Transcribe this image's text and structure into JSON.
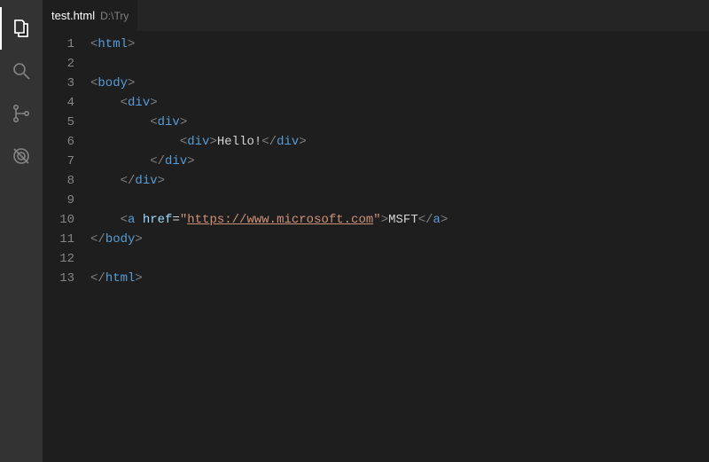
{
  "activitybar": {
    "items": [
      {
        "name": "explorer-icon",
        "active": true
      },
      {
        "name": "search-icon",
        "active": false
      },
      {
        "name": "source-control-icon",
        "active": false
      },
      {
        "name": "debug-icon",
        "active": false
      }
    ]
  },
  "tab": {
    "filename": "test.html",
    "directory": "D:\\Try"
  },
  "code": {
    "lines": [
      {
        "num": "1",
        "indent": "",
        "tokens": [
          [
            "punc",
            "<"
          ],
          [
            "tag",
            "html"
          ],
          [
            "punc",
            ">"
          ]
        ]
      },
      {
        "num": "2",
        "indent": "",
        "tokens": []
      },
      {
        "num": "3",
        "indent": "",
        "tokens": [
          [
            "punc",
            "<"
          ],
          [
            "tag",
            "body"
          ],
          [
            "punc",
            ">"
          ]
        ]
      },
      {
        "num": "4",
        "indent": "    ",
        "tokens": [
          [
            "punc",
            "<"
          ],
          [
            "tag",
            "div"
          ],
          [
            "punc",
            ">"
          ]
        ]
      },
      {
        "num": "5",
        "indent": "        ",
        "tokens": [
          [
            "punc",
            "<"
          ],
          [
            "tag",
            "div"
          ],
          [
            "punc",
            ">"
          ]
        ]
      },
      {
        "num": "6",
        "indent": "            ",
        "tokens": [
          [
            "punc",
            "<"
          ],
          [
            "tag",
            "div"
          ],
          [
            "punc",
            ">"
          ],
          [
            "text",
            "Hello!"
          ],
          [
            "punc",
            "</"
          ],
          [
            "tag",
            "div"
          ],
          [
            "punc",
            ">"
          ]
        ]
      },
      {
        "num": "7",
        "indent": "        ",
        "tokens": [
          [
            "punc",
            "</"
          ],
          [
            "tag",
            "div"
          ],
          [
            "punc",
            ">"
          ]
        ]
      },
      {
        "num": "8",
        "indent": "    ",
        "tokens": [
          [
            "punc",
            "</"
          ],
          [
            "tag",
            "div"
          ],
          [
            "punc",
            ">"
          ]
        ]
      },
      {
        "num": "9",
        "indent": "",
        "tokens": []
      },
      {
        "num": "10",
        "indent": "    ",
        "tokens": [
          [
            "punc",
            "<"
          ],
          [
            "tag",
            "a"
          ],
          [
            "text",
            " "
          ],
          [
            "attr",
            "href"
          ],
          [
            "op",
            "="
          ],
          [
            "str",
            "\""
          ],
          [
            "url",
            "https://www.microsoft.com"
          ],
          [
            "str",
            "\""
          ],
          [
            "punc",
            ">"
          ],
          [
            "text",
            "MSFT"
          ],
          [
            "punc",
            "</"
          ],
          [
            "tag",
            "a"
          ],
          [
            "punc",
            ">"
          ]
        ]
      },
      {
        "num": "11",
        "indent": "",
        "tokens": [
          [
            "punc",
            "</"
          ],
          [
            "tag",
            "body"
          ],
          [
            "punc",
            ">"
          ]
        ]
      },
      {
        "num": "12",
        "indent": "",
        "tokens": []
      },
      {
        "num": "13",
        "indent": "",
        "tokens": [
          [
            "punc",
            "</"
          ],
          [
            "tag",
            "html"
          ],
          [
            "punc",
            ">"
          ]
        ]
      }
    ]
  }
}
